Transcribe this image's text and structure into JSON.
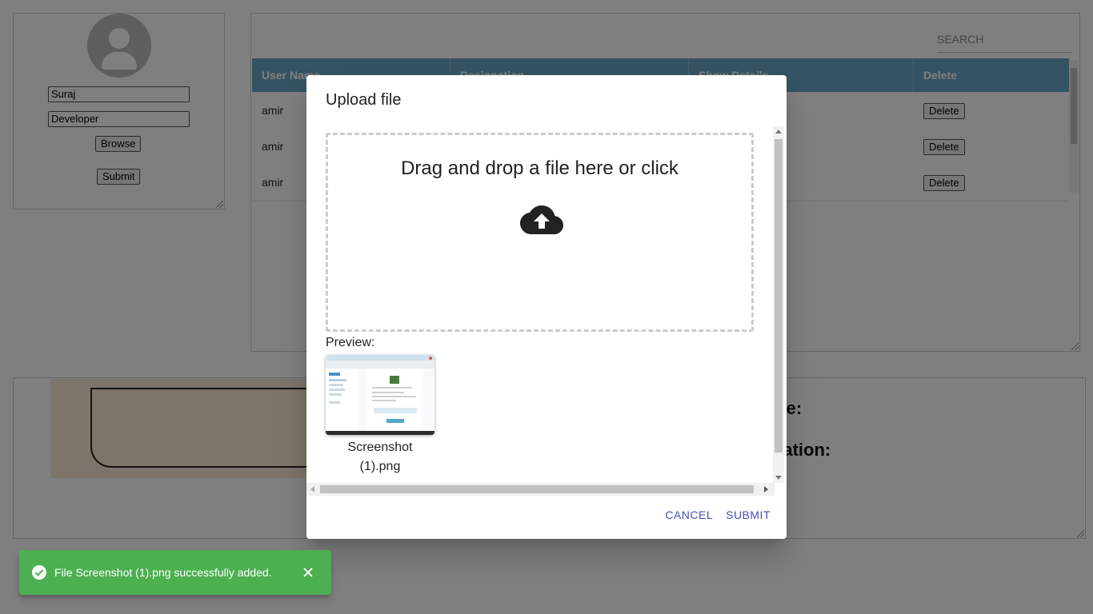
{
  "profile": {
    "name_value": "Suraj",
    "designation_value": "Developer",
    "browse_label": "Browse",
    "submit_label": "Submit"
  },
  "table": {
    "search_placeholder": "SEARCH",
    "columns": [
      "User Name",
      "Designation",
      "Show Details",
      "Delete"
    ],
    "rows": [
      {
        "user": "amir",
        "delete_label": "Delete"
      },
      {
        "user": "amir",
        "delete_label": "Delete"
      },
      {
        "user": "amir",
        "delete_label": "Delete"
      }
    ]
  },
  "detail": {
    "name_label": "Name:",
    "designation_label": "Designation:"
  },
  "dialog": {
    "title": "Upload file",
    "dropzone_text": "Drag and drop a file here or click",
    "preview_label": "Preview:",
    "file_name_line1": "Screenshot",
    "file_name_line2": "(1).png",
    "cancel_label": "CANCEL",
    "submit_label": "SUBMIT",
    "upload_icon": "cloud-upload-icon"
  },
  "snackbar": {
    "message": "File Screenshot (1).png successfully added.",
    "icon": "check-circle-icon",
    "close_icon": "close-icon",
    "color": "#4caf50"
  },
  "colors": {
    "table_header": "#6aa7c4",
    "accent": "#3f51b5"
  }
}
